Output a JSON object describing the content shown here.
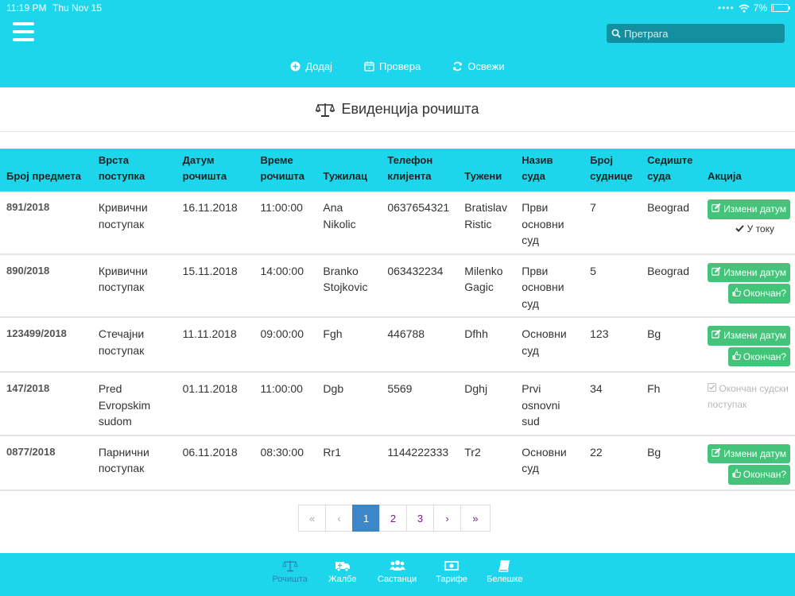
{
  "status_bar": {
    "time": "11:19 PM",
    "date": "Thu Nov 15",
    "battery": "7%",
    "battery_level": 0.07
  },
  "search": {
    "placeholder": "Претрага"
  },
  "toolbar": {
    "add_label": "Додај",
    "check_label": "Провера",
    "refresh_label": "Освежи"
  },
  "page": {
    "title": "Евиденција рочишта"
  },
  "table": {
    "headers": [
      "Број предмета",
      "Врста поступка",
      "Датум рочишта",
      "Време рочишта",
      "Тужилац",
      "Телефон клијента",
      "Тужени",
      "Назив суда",
      "Број суднице",
      "Седиште суда",
      "Акција"
    ],
    "rows": [
      {
        "case_no": "891/2018",
        "type": "Кривични поступак",
        "date": "16.11.2018",
        "time": "11:00:00",
        "plaintiff": "Ana Nikolic",
        "phone": "0637654321",
        "defendant": "Bratislav Ristic",
        "court": "Први основни суд",
        "room": "7",
        "seat": "Beograd",
        "status": "in_progress"
      },
      {
        "case_no": "890/2018",
        "type": "Кривични поступак",
        "date": "15.11.2018",
        "time": "14:00:00",
        "plaintiff": "Branko Stojkovic",
        "phone": "063432234",
        "defendant": "Milenko Gagic",
        "court": "Први основни суд",
        "room": "5",
        "seat": "Beograd",
        "status": "open"
      },
      {
        "case_no": "123499/2018",
        "type": "Стечајни поступак",
        "date": "11.11.2018",
        "time": "09:00:00",
        "plaintiff": "Fgh",
        "phone": "446788",
        "defendant": "Dfhh",
        "court": "Основни суд",
        "room": "123",
        "seat": "Bg",
        "status": "open"
      },
      {
        "case_no": "147/2018",
        "type": "Pred Evropskim sudom",
        "date": "01.11.2018",
        "time": "11:00:00",
        "plaintiff": "Dgb",
        "phone": "5569",
        "defendant": "Dghj",
        "court": "Prvi osnovni sud",
        "room": "34",
        "seat": "Fh",
        "status": "finished"
      },
      {
        "case_no": "0877/2018",
        "type": "Парнични поступак",
        "date": "06.11.2018",
        "time": "08:30:00",
        "plaintiff": "Rr1",
        "phone": "1144222333",
        "defendant": "Tr2",
        "court": "Основни суд",
        "room": "22",
        "seat": "Bg",
        "status": "open"
      }
    ],
    "actions": {
      "change_date": "Измени датум",
      "in_progress": "У току",
      "finished_q": "Окончан?",
      "finished_done": "Окончан судски поступак"
    }
  },
  "pagination": {
    "first": "«",
    "prev": "‹",
    "pages": [
      "1",
      "2",
      "3"
    ],
    "current": "1",
    "next": "›",
    "last": "»"
  },
  "bottom_nav": [
    {
      "label": "Рочишта",
      "icon": "scales-icon",
      "active": true
    },
    {
      "label": "Жалбе",
      "icon": "ambulance-icon",
      "active": false
    },
    {
      "label": "Састанци",
      "icon": "users-icon",
      "active": false
    },
    {
      "label": "Тарифе",
      "icon": "money-icon",
      "active": false
    },
    {
      "label": "Белешке",
      "icon": "book-icon",
      "active": false
    }
  ],
  "colors": {
    "accent": "#1ed6ec",
    "success": "#43c47a",
    "pagination_active": "#3c87c7"
  }
}
